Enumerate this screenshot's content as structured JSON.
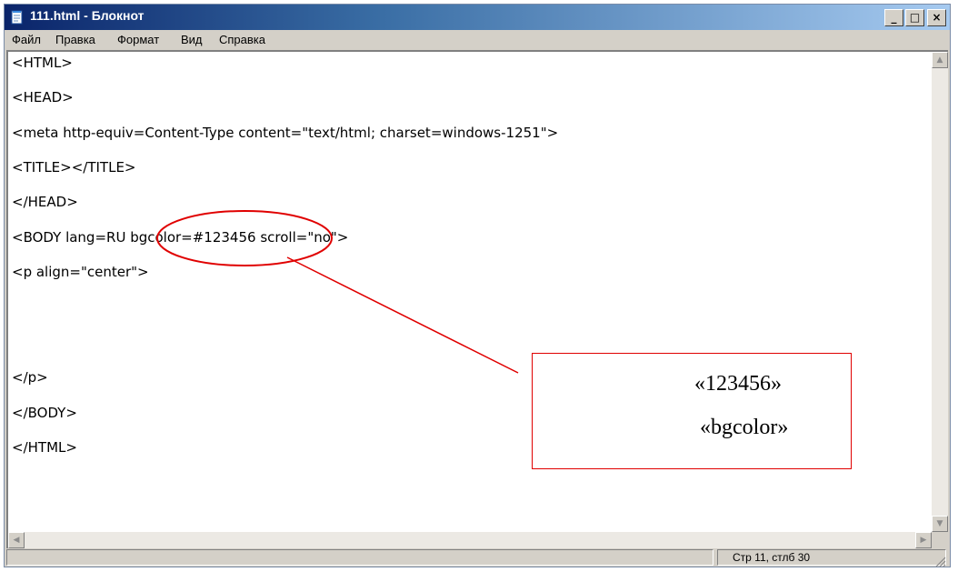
{
  "window": {
    "title": "111.html - Блокнот",
    "controls": {
      "minimize": "_",
      "maximize": "□",
      "close": "×"
    }
  },
  "menu": [
    {
      "label": "Файл"
    },
    {
      "label": "Правка"
    },
    {
      "label": "Формат"
    },
    {
      "label": "Вид"
    },
    {
      "label": "Справка"
    }
  ],
  "editor": {
    "lines": [
      "<HTML>",
      "<HEAD>",
      "<meta http-equiv=Content-Type content=\"text/html; charset=windows-1251\">",
      "<TITLE></TITLE>",
      "</HEAD>",
      "<BODY lang=RU bgcolor=#123456 scroll=\"no\">",
      "<p align=\"center\">",
      "",
      "",
      "</p>",
      "</BODY>",
      "</HTML>"
    ]
  },
  "status": {
    "position": "Стр 11, стлб 30"
  },
  "annotation": {
    "line1": "«123456»",
    "line2": "«bgcolor»",
    "color": "#e00000"
  },
  "icons": {
    "app": "notepad-icon",
    "scroll_up": "arrow-up-icon",
    "scroll_down": "arrow-down-icon",
    "scroll_left": "arrow-left-icon",
    "scroll_right": "arrow-right-icon",
    "grip": "resize-grip-icon"
  }
}
